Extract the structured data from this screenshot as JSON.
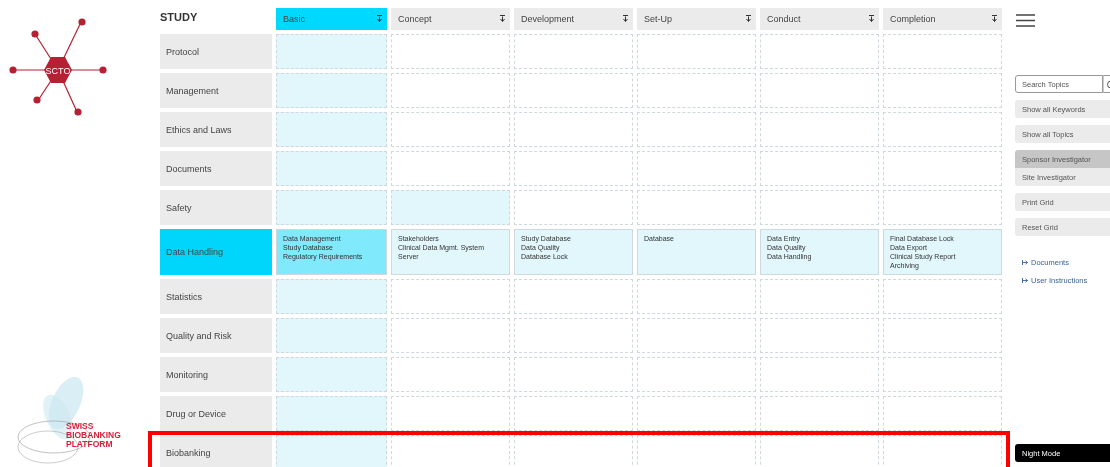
{
  "logo": {
    "text": "SCTO"
  },
  "partner_logo": {
    "lines": [
      "SWISS",
      "BIOBANKING",
      "PLATFORM"
    ]
  },
  "grid": {
    "title": "STUDY",
    "columns": [
      {
        "label": "Basic",
        "selected": true
      },
      {
        "label": "Concept",
        "selected": false
      },
      {
        "label": "Development",
        "selected": false
      },
      {
        "label": "Set-Up",
        "selected": false
      },
      {
        "label": "Conduct",
        "selected": false
      },
      {
        "label": "Completion",
        "selected": false
      }
    ],
    "rows": [
      {
        "label": "Protocol",
        "selected": false,
        "cells": [
          {
            "highlighted": true
          },
          {
            "highlighted": false
          },
          {
            "highlighted": false
          },
          {
            "highlighted": false
          },
          {
            "highlighted": false
          },
          {
            "highlighted": false
          }
        ]
      },
      {
        "label": "Management",
        "selected": false,
        "cells": [
          {
            "highlighted": true
          },
          {
            "highlighted": false
          },
          {
            "highlighted": false
          },
          {
            "highlighted": false
          },
          {
            "highlighted": false
          },
          {
            "highlighted": false
          }
        ]
      },
      {
        "label": "Ethics and Laws",
        "selected": false,
        "cells": [
          {
            "highlighted": true
          },
          {
            "highlighted": false
          },
          {
            "highlighted": false
          },
          {
            "highlighted": false
          },
          {
            "highlighted": false
          },
          {
            "highlighted": false
          }
        ]
      },
      {
        "label": "Documents",
        "selected": false,
        "cells": [
          {
            "highlighted": true
          },
          {
            "highlighted": false
          },
          {
            "highlighted": false
          },
          {
            "highlighted": false
          },
          {
            "highlighted": false
          },
          {
            "highlighted": false
          }
        ]
      },
      {
        "label": "Safety",
        "selected": false,
        "cells": [
          {
            "highlighted": true
          },
          {
            "highlighted": true
          },
          {
            "highlighted": false
          },
          {
            "highlighted": false
          },
          {
            "highlighted": false
          },
          {
            "highlighted": false
          }
        ]
      },
      {
        "label": "Data Handling",
        "selected": true,
        "cells": [
          {
            "highlighted": true,
            "items": [
              "Data Management",
              "Study Database",
              "Regulatory Requirements"
            ]
          },
          {
            "highlighted": true,
            "items": [
              "Stakeholders",
              "Clinical Data Mgmt. System",
              "Server"
            ]
          },
          {
            "highlighted": true,
            "items": [
              "Study Database",
              "Data Quality",
              "Database Lock"
            ]
          },
          {
            "highlighted": true,
            "items": [
              "Database"
            ]
          },
          {
            "highlighted": true,
            "items": [
              "Data Entry",
              "Data Quality",
              "Data Handling"
            ]
          },
          {
            "highlighted": true,
            "items": [
              "Final Database Lock",
              "Data Export",
              "Clinical Study Report",
              "Archiving"
            ]
          }
        ]
      },
      {
        "label": "Statistics",
        "selected": false,
        "cells": [
          {
            "highlighted": true
          },
          {
            "highlighted": false
          },
          {
            "highlighted": false
          },
          {
            "highlighted": false
          },
          {
            "highlighted": false
          },
          {
            "highlighted": false
          }
        ]
      },
      {
        "label": "Quality and Risk",
        "selected": false,
        "cells": [
          {
            "highlighted": true
          },
          {
            "highlighted": false
          },
          {
            "highlighted": false
          },
          {
            "highlighted": false
          },
          {
            "highlighted": false
          },
          {
            "highlighted": false
          }
        ]
      },
      {
        "label": "Monitoring",
        "selected": false,
        "cells": [
          {
            "highlighted": true
          },
          {
            "highlighted": false
          },
          {
            "highlighted": false
          },
          {
            "highlighted": false
          },
          {
            "highlighted": false
          },
          {
            "highlighted": false
          }
        ]
      },
      {
        "label": "Drug or Device",
        "selected": false,
        "cells": [
          {
            "highlighted": true
          },
          {
            "highlighted": false
          },
          {
            "highlighted": false
          },
          {
            "highlighted": false
          },
          {
            "highlighted": false
          },
          {
            "highlighted": false
          }
        ]
      },
      {
        "label": "Biobanking",
        "selected": false,
        "marked": true,
        "cells": [
          {
            "highlighted": true
          },
          {
            "highlighted": false
          },
          {
            "highlighted": false
          },
          {
            "highlighted": false
          },
          {
            "highlighted": false
          },
          {
            "highlighted": false
          }
        ]
      }
    ]
  },
  "sidebar": {
    "search": {
      "placeholder": "Search Topics"
    },
    "buttons": [
      {
        "label": "Show all Keywords"
      },
      {
        "label": "Show all Topics"
      }
    ],
    "roles": [
      {
        "label": "Sponsor Investigator",
        "selected": true
      },
      {
        "label": "Site Investigator",
        "selected": false
      }
    ],
    "actions": [
      {
        "label": "Print Grid"
      },
      {
        "label": "Reset Grid"
      }
    ],
    "links": [
      {
        "label": "Documents"
      },
      {
        "label": "User Instructions"
      }
    ],
    "night_mode": {
      "label": "Night Mode"
    }
  }
}
